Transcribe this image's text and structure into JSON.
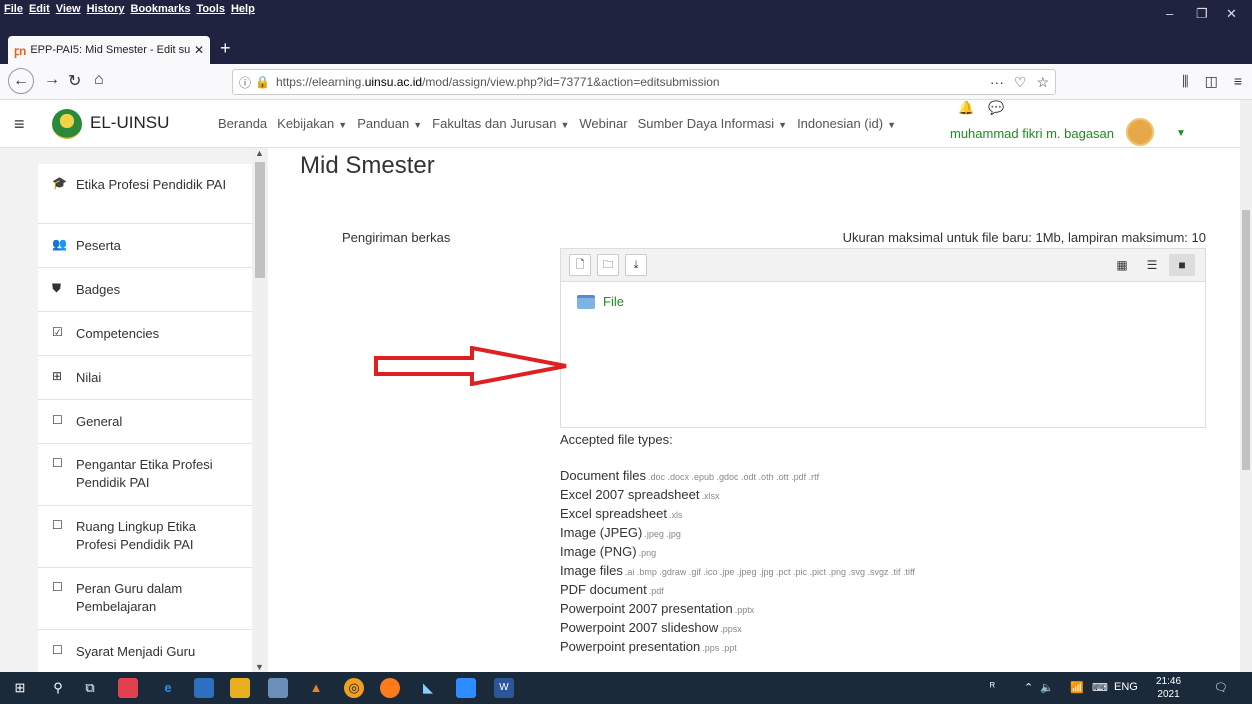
{
  "browser": {
    "menu": [
      "File",
      "Edit",
      "View",
      "History",
      "Bookmarks",
      "Tools",
      "Help"
    ],
    "tab_title": "EPP-PAI5: Mid Smester - Edit su",
    "tab_close": "✕",
    "new_tab": "+",
    "url_prefix": "https://elearning.",
    "url_domain": "uinsu.ac.id",
    "url_path": "/mod/assign/view.php?id=73771&action=editsubmission",
    "win_minimize": "–",
    "win_restore": "❐",
    "win_close": "✕"
  },
  "site": {
    "brand": "EL-UINSU",
    "nav": [
      {
        "label": "Beranda",
        "caret": ""
      },
      {
        "label": "Kebijakan",
        "caret": "▼"
      },
      {
        "label": "Panduan",
        "caret": "▼"
      },
      {
        "label": "Fakultas dan Jurusan",
        "caret": "▼"
      },
      {
        "label": "Webinar",
        "caret": ""
      },
      {
        "label": "Sumber Daya Informasi",
        "caret": "▼"
      },
      {
        "label": "Indonesian (id)",
        "caret": "▼"
      }
    ],
    "username": "muhammad fikri m. bagasan"
  },
  "drawer": {
    "items": [
      {
        "icon": "graduation-cap-icon",
        "glyph": "🎓",
        "label": "Etika Profesi Pendidik PAI"
      },
      {
        "icon": "users-icon",
        "glyph": "👥",
        "label": "Peserta"
      },
      {
        "icon": "shield-icon",
        "glyph": "⛊",
        "label": "Badges"
      },
      {
        "icon": "checkbox-icon",
        "glyph": "☑",
        "label": "Competencies"
      },
      {
        "icon": "table-icon",
        "glyph": "⊞",
        "label": "Nilai"
      },
      {
        "icon": "folder-icon",
        "glyph": "☐",
        "label": "General"
      },
      {
        "icon": "folder-icon",
        "glyph": "☐",
        "label": "Pengantar Etika Profesi Pendidik PAI"
      },
      {
        "icon": "folder-icon",
        "glyph": "☐",
        "label": "Ruang Lingkup Etika Profesi Pendidik PAI"
      },
      {
        "icon": "folder-icon",
        "glyph": "☐",
        "label": "Peran Guru dalam Pembelajaran"
      },
      {
        "icon": "folder-icon",
        "glyph": "☐",
        "label": "Syarat Menjadi Guru"
      }
    ]
  },
  "main": {
    "title": "Mid Smester",
    "field_label": "Pengiriman berkas",
    "max_size": "Ukuran maksimal untuk file baru: 1Mb, lampiran maksimum: 10",
    "folder_name": "File",
    "accepted_title": "Accepted file types:",
    "file_types": [
      {
        "name": "Document files",
        "ext": ".doc .docx .epub .gdoc .odt .oth .ott .pdf .rtf"
      },
      {
        "name": "Excel 2007 spreadsheet",
        "ext": ".xlsx"
      },
      {
        "name": "Excel spreadsheet",
        "ext": ".xls"
      },
      {
        "name": "Image (JPEG)",
        "ext": ".jpeg .jpg"
      },
      {
        "name": "Image (PNG)",
        "ext": ".png"
      },
      {
        "name": "Image files",
        "ext": ".ai .bmp .gdraw .gif .ico .jpe .jpeg .jpg .pct .pic .pict .png .svg .svgz .tif .tiff"
      },
      {
        "name": "PDF document",
        "ext": ".pdf"
      },
      {
        "name": "Powerpoint 2007 presentation",
        "ext": ".pptx"
      },
      {
        "name": "Powerpoint 2007 slideshow",
        "ext": ".ppsx"
      },
      {
        "name": "Powerpoint presentation",
        "ext": ".pps .ppt"
      }
    ]
  },
  "taskbar": {
    "lang": "ENG",
    "time": "21:46",
    "date": "2021"
  },
  "colors": {
    "accent_green": "#1a8f1a",
    "arrow_red": "#e02020",
    "browser_dark": "#202340"
  }
}
